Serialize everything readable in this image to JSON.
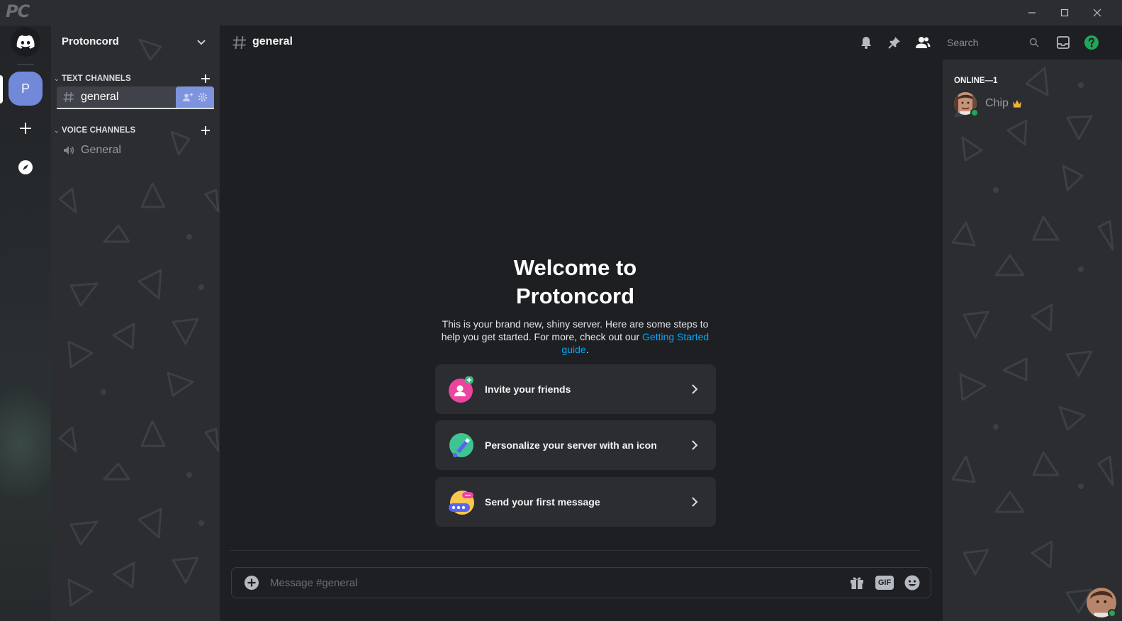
{
  "titlebar": {
    "app_logo": "PC",
    "minimize_icon": "minimize-icon",
    "maximize_icon": "maximize-icon",
    "close_icon": "close-icon"
  },
  "rail": {
    "server_initial": "P",
    "home_icon": "discord-icon",
    "add_icon": "plus-icon",
    "explore_icon": "compass-icon",
    "accent": "#7289da"
  },
  "sidebar": {
    "server_name": "Protoncord",
    "categories": [
      {
        "label": "TEXT CHANNELS",
        "channels": [
          {
            "label": "general",
            "type": "text",
            "active": true
          }
        ]
      },
      {
        "label": "VOICE CHANNELS",
        "channels": [
          {
            "label": "General",
            "type": "voice",
            "active": false
          }
        ]
      }
    ]
  },
  "main": {
    "channel_title": "general",
    "search_placeholder": "Search",
    "welcome_title": "Welcome to Protoncord",
    "welcome_text_before_link": "This is your brand new, shiny server. Here are some steps to help you get started. For more, check out our ",
    "welcome_link": "Getting Started guide",
    "welcome_text_after_link": ".",
    "cards": [
      {
        "label": "Invite your friends",
        "icon": "invite-friends-icon"
      },
      {
        "label": "Personalize your server with an icon",
        "icon": "personalize-icon"
      },
      {
        "label": "Send your first message",
        "icon": "send-message-icon"
      }
    ],
    "composer_placeholder": "Message #general",
    "gif_label": "GIF"
  },
  "members": {
    "heading": "ONLINE—1",
    "list": [
      {
        "name": "Chip",
        "owner": true,
        "status": "online"
      }
    ]
  },
  "colors": {
    "background": "#1e1f22",
    "sidebar": "#2b2d31",
    "link": "#00a8fc",
    "online": "#23a55a",
    "crown": "#f0b232",
    "help": "#23a55a"
  }
}
